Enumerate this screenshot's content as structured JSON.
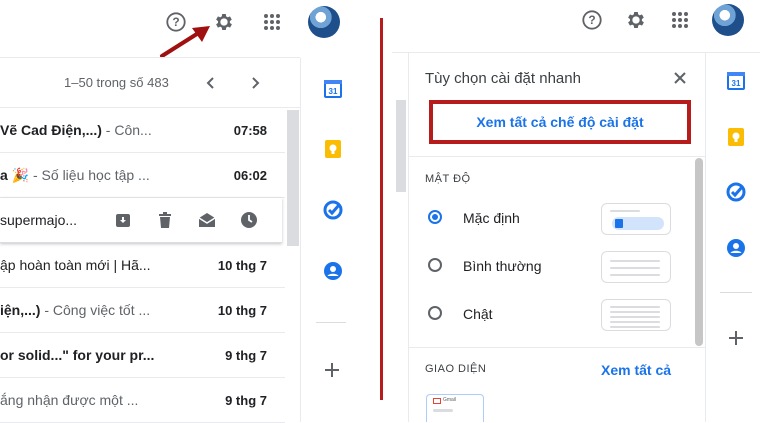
{
  "left": {
    "pagination": "1–50 trong số 483",
    "rows": [
      {
        "subject_bold": "Vẽ Cad Điện,...)",
        "subject_rest": " - Côn...",
        "date": "07:58"
      },
      {
        "subject_bold": "a 🎉",
        "subject_rest": " - Số liệu học tập ...",
        "date": "06:02"
      },
      {
        "subject_bold": "",
        "subject_rest": "supermajo...",
        "date": ""
      },
      {
        "subject_bold": "",
        "subject_rest": "ập hoàn toàn mới | Hã...",
        "date": "10 thg 7"
      },
      {
        "subject_bold": "iện,...)",
        "subject_rest": " - Công việc tốt ...",
        "date": "10 thg 7"
      },
      {
        "subject_bold": "or solid...\" for your pr...",
        "subject_rest": "",
        "date": "9 thg 7"
      },
      {
        "subject_bold": "",
        "subject_rest": "ắng nhận được một ...",
        "date": "9 thg 7"
      }
    ]
  },
  "quick_settings": {
    "title": "Tùy chọn cài đặt nhanh",
    "see_all_settings": "Xem tất cả chế độ cài đặt",
    "density_heading": "MẬT ĐỘ",
    "density_options": [
      "Mặc định",
      "Bình thường",
      "Chật"
    ],
    "theme_heading": "GIAO DIỆN",
    "theme_see_all": "Xem tất cả",
    "theme_thumb_text": "Gmail"
  },
  "colors": {
    "accent": "#1a73e8",
    "highlight_box": "#b71c1c",
    "arrow": "#a01010",
    "divider": "#b71c1c"
  }
}
